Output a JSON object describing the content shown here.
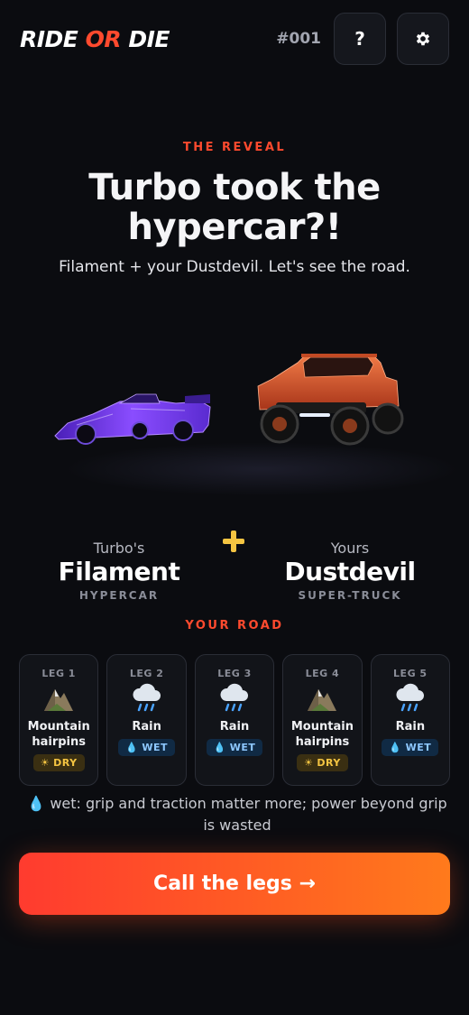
{
  "header": {
    "logo_ride": "RIDE",
    "logo_or": "OR",
    "logo_die": "DIE",
    "run_id": "#001",
    "help_label": "?",
    "settings_icon": "gear-icon"
  },
  "reveal": {
    "eyebrow": "THE REVEAL",
    "headline": "Turbo took the hypercar?!",
    "subline": "Filament + your Dustdevil. Let's see the road."
  },
  "matchup": {
    "left": {
      "owner": "Turbo's",
      "name": "Filament",
      "class": "HYPERCAR",
      "color": "#7a3cff"
    },
    "right": {
      "owner": "Yours",
      "name": "Dustdevil",
      "class": "SUPER-TRUCK",
      "color": "#e0552a"
    },
    "plus_color": "#f5c542"
  },
  "road": {
    "eyebrow": "YOUR ROAD",
    "legs": [
      {
        "label": "LEG 1",
        "icon": "mountain-icon",
        "surface_line1": "Mountain",
        "surface_line2": "hairpins",
        "condition": "DRY"
      },
      {
        "label": "LEG 2",
        "icon": "rain-cloud-icon",
        "surface_line1": "Rain",
        "surface_line2": "",
        "condition": "WET"
      },
      {
        "label": "LEG 3",
        "icon": "rain-cloud-icon",
        "surface_line1": "Rain",
        "surface_line2": "",
        "condition": "WET"
      },
      {
        "label": "LEG 4",
        "icon": "mountain-icon",
        "surface_line1": "Mountain",
        "surface_line2": "hairpins",
        "condition": "DRY"
      },
      {
        "label": "LEG 5",
        "icon": "rain-cloud-icon",
        "surface_line1": "Rain",
        "surface_line2": "",
        "condition": "WET"
      }
    ],
    "note": "wet: grip and traction matter more; power beyond grip is wasted"
  },
  "cta": {
    "label": "Call the legs →"
  },
  "colors": {
    "accent": "#ff4a2e",
    "background": "#0b0c10",
    "dry": "#f5c542",
    "wet": "#8ec8ff"
  }
}
